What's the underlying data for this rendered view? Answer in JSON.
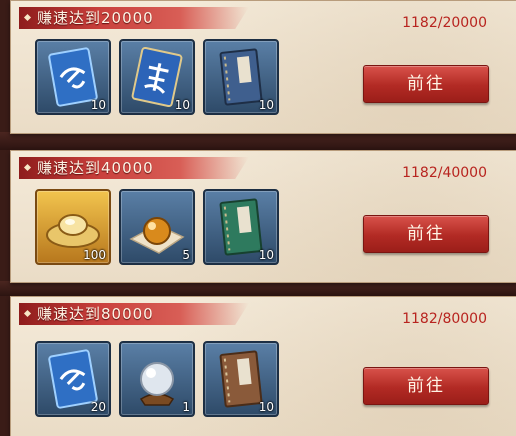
{
  "tasks": [
    {
      "title": "赚速达到20000",
      "progress": "1182/20000",
      "button": "前往",
      "rewards": [
        {
          "icon": "blue-card-fen-icon",
          "count": "10"
        },
        {
          "icon": "blue-card-mu-icon",
          "count": "10"
        },
        {
          "icon": "blue-book-icon",
          "count": "10"
        }
      ]
    },
    {
      "title": "赚速达到40000",
      "progress": "1182/40000",
      "button": "前往",
      "rewards": [
        {
          "icon": "gold-ingot-icon",
          "count": "100"
        },
        {
          "icon": "golden-orb-icon",
          "count": "5"
        },
        {
          "icon": "green-book-icon",
          "count": "10"
        }
      ]
    },
    {
      "title": "赚速达到80000",
      "progress": "1182/80000",
      "button": "前往",
      "rewards": [
        {
          "icon": "blue-card-fen-icon",
          "count": "20"
        },
        {
          "icon": "crystal-ball-icon",
          "count": "1"
        },
        {
          "icon": "brown-book-icon",
          "count": "10"
        }
      ]
    }
  ],
  "colors": {
    "accent_red": "#b8241f",
    "panel": "#efe4d2"
  }
}
